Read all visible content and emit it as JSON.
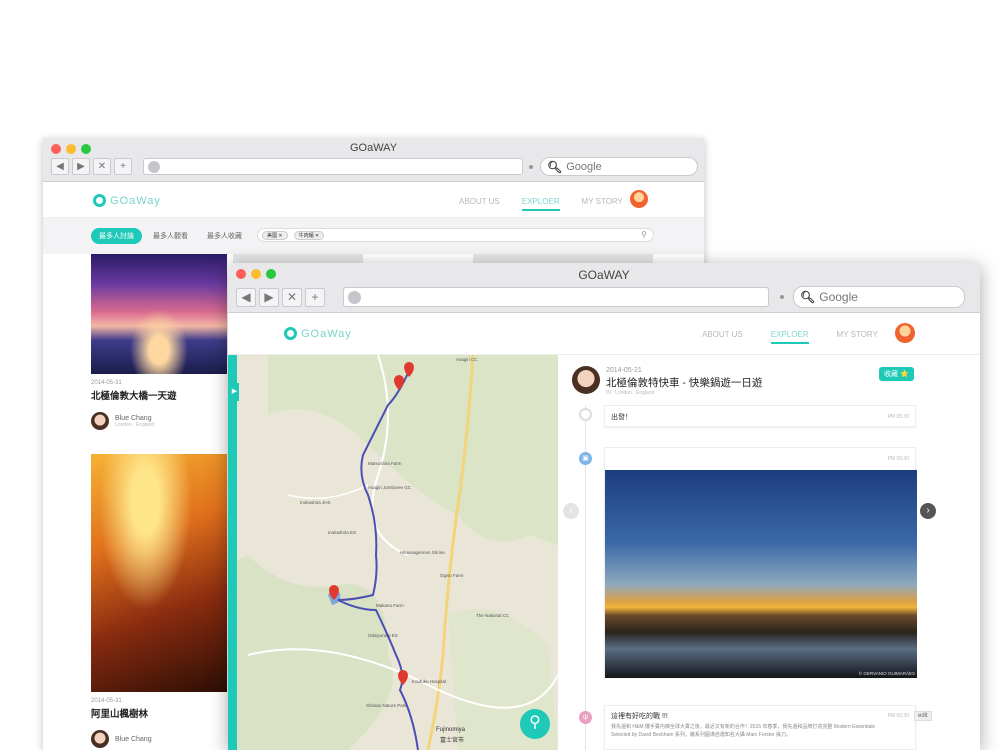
{
  "back_window": {
    "title": "GOaWAY",
    "search_placeholder": "Google",
    "logo": "GOaWay",
    "nav": [
      "ABOUT US",
      "EXPLOER",
      "MY STORY"
    ],
    "filters": {
      "active": "最多人討論",
      "tabs": [
        "最多人觀看",
        "最多人收藏"
      ],
      "tags": [
        "美國 ✕",
        "牛肉麵 ✕"
      ]
    },
    "cards": [
      {
        "date": "2014-05-31",
        "title": "北極倫敦大橋一天遊",
        "user": "Blue Chang",
        "location": "London , England"
      },
      {
        "date": "2014-05-31",
        "title": "阿里山楓樹林",
        "user": "Blue Chang",
        "location": ""
      }
    ]
  },
  "front_window": {
    "title": "GOaWAY",
    "search_placeholder": "Google",
    "logo": "GOaWay",
    "nav": [
      "ABOUT US",
      "EXPLOER",
      "MY STORY"
    ],
    "story": {
      "date": "2014-05-21",
      "title": "北極倫敦特快車 - 快樂鍋遊一日遊",
      "location": "IN : London , England",
      "fav_label": "收藏 ⭐",
      "posts": [
        {
          "text": "出發！",
          "time": "PM 05:30"
        },
        {
          "text": "",
          "time": "PM 05:30",
          "credit": "© GERVANIO GUIMARÃES"
        },
        {
          "text": "這裡有好吃的戰 !!!",
          "time": "PM 05:30",
          "body": "我先還和 H&M 攜手賣內褲全球大賣之後，最近又有新的合作！2015 年春季，我先還和品牌打造完整 Modern Essentials Selected by David Beckham 系列，繼系列圓滿自邀知名大攝 Marc Forster 操刀。"
        }
      ],
      "edit_label": "edit"
    },
    "map_labels": [
      "Asagiri CC",
      "Matsushita Farm",
      "Inokashira JHS",
      "Asagiri Jamboree GC",
      "Inokashira ES",
      "Hitoanagennon Shrine",
      "Ogiso Farm",
      "Makano Farm",
      "Odaiyunsai ES",
      "The National CC",
      "Koufuku Hospital",
      "Shiraito Nature Park",
      "Fujinomiya",
      "富士宮市"
    ]
  },
  "colors": {
    "accent": "#1ec9b7",
    "map_bg": "#e9e5d7",
    "route": "#4a4fb5"
  }
}
